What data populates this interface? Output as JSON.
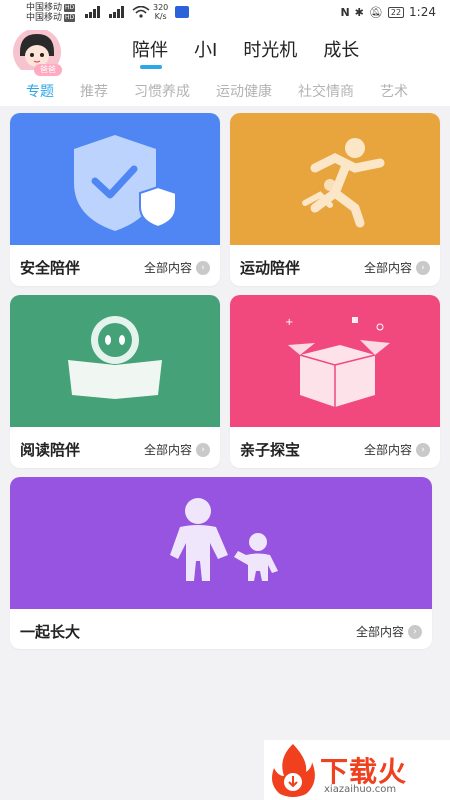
{
  "status": {
    "carrier1": "中国移动",
    "carrier2": "中国移动",
    "hd": "HD",
    "speed_value": "320",
    "speed_unit": "K/s",
    "battery": "22",
    "time": "1:24"
  },
  "header": {
    "avatar_badge": "爸爸",
    "main_tabs": [
      "陪伴",
      "小I",
      "时光机",
      "成长"
    ],
    "sub_tabs": [
      "专题",
      "推荐",
      "习惯养成",
      "运动健康",
      "社交情商",
      "艺术"
    ]
  },
  "cards": [
    {
      "title": "安全陪伴",
      "more": "全部内容",
      "color": "#4f86f3"
    },
    {
      "title": "运动陪伴",
      "more": "全部内容",
      "color": "#e8a53e"
    },
    {
      "title": "阅读陪伴",
      "more": "全部内容",
      "color": "#45a178"
    },
    {
      "title": "亲子探宝",
      "more": "全部内容",
      "color": "#f1497e"
    },
    {
      "title": "一起长大",
      "more": "全部内容",
      "color": "#9654e0"
    }
  ],
  "watermark": {
    "brand": "下载火",
    "url": "xiazaihuo.com"
  }
}
